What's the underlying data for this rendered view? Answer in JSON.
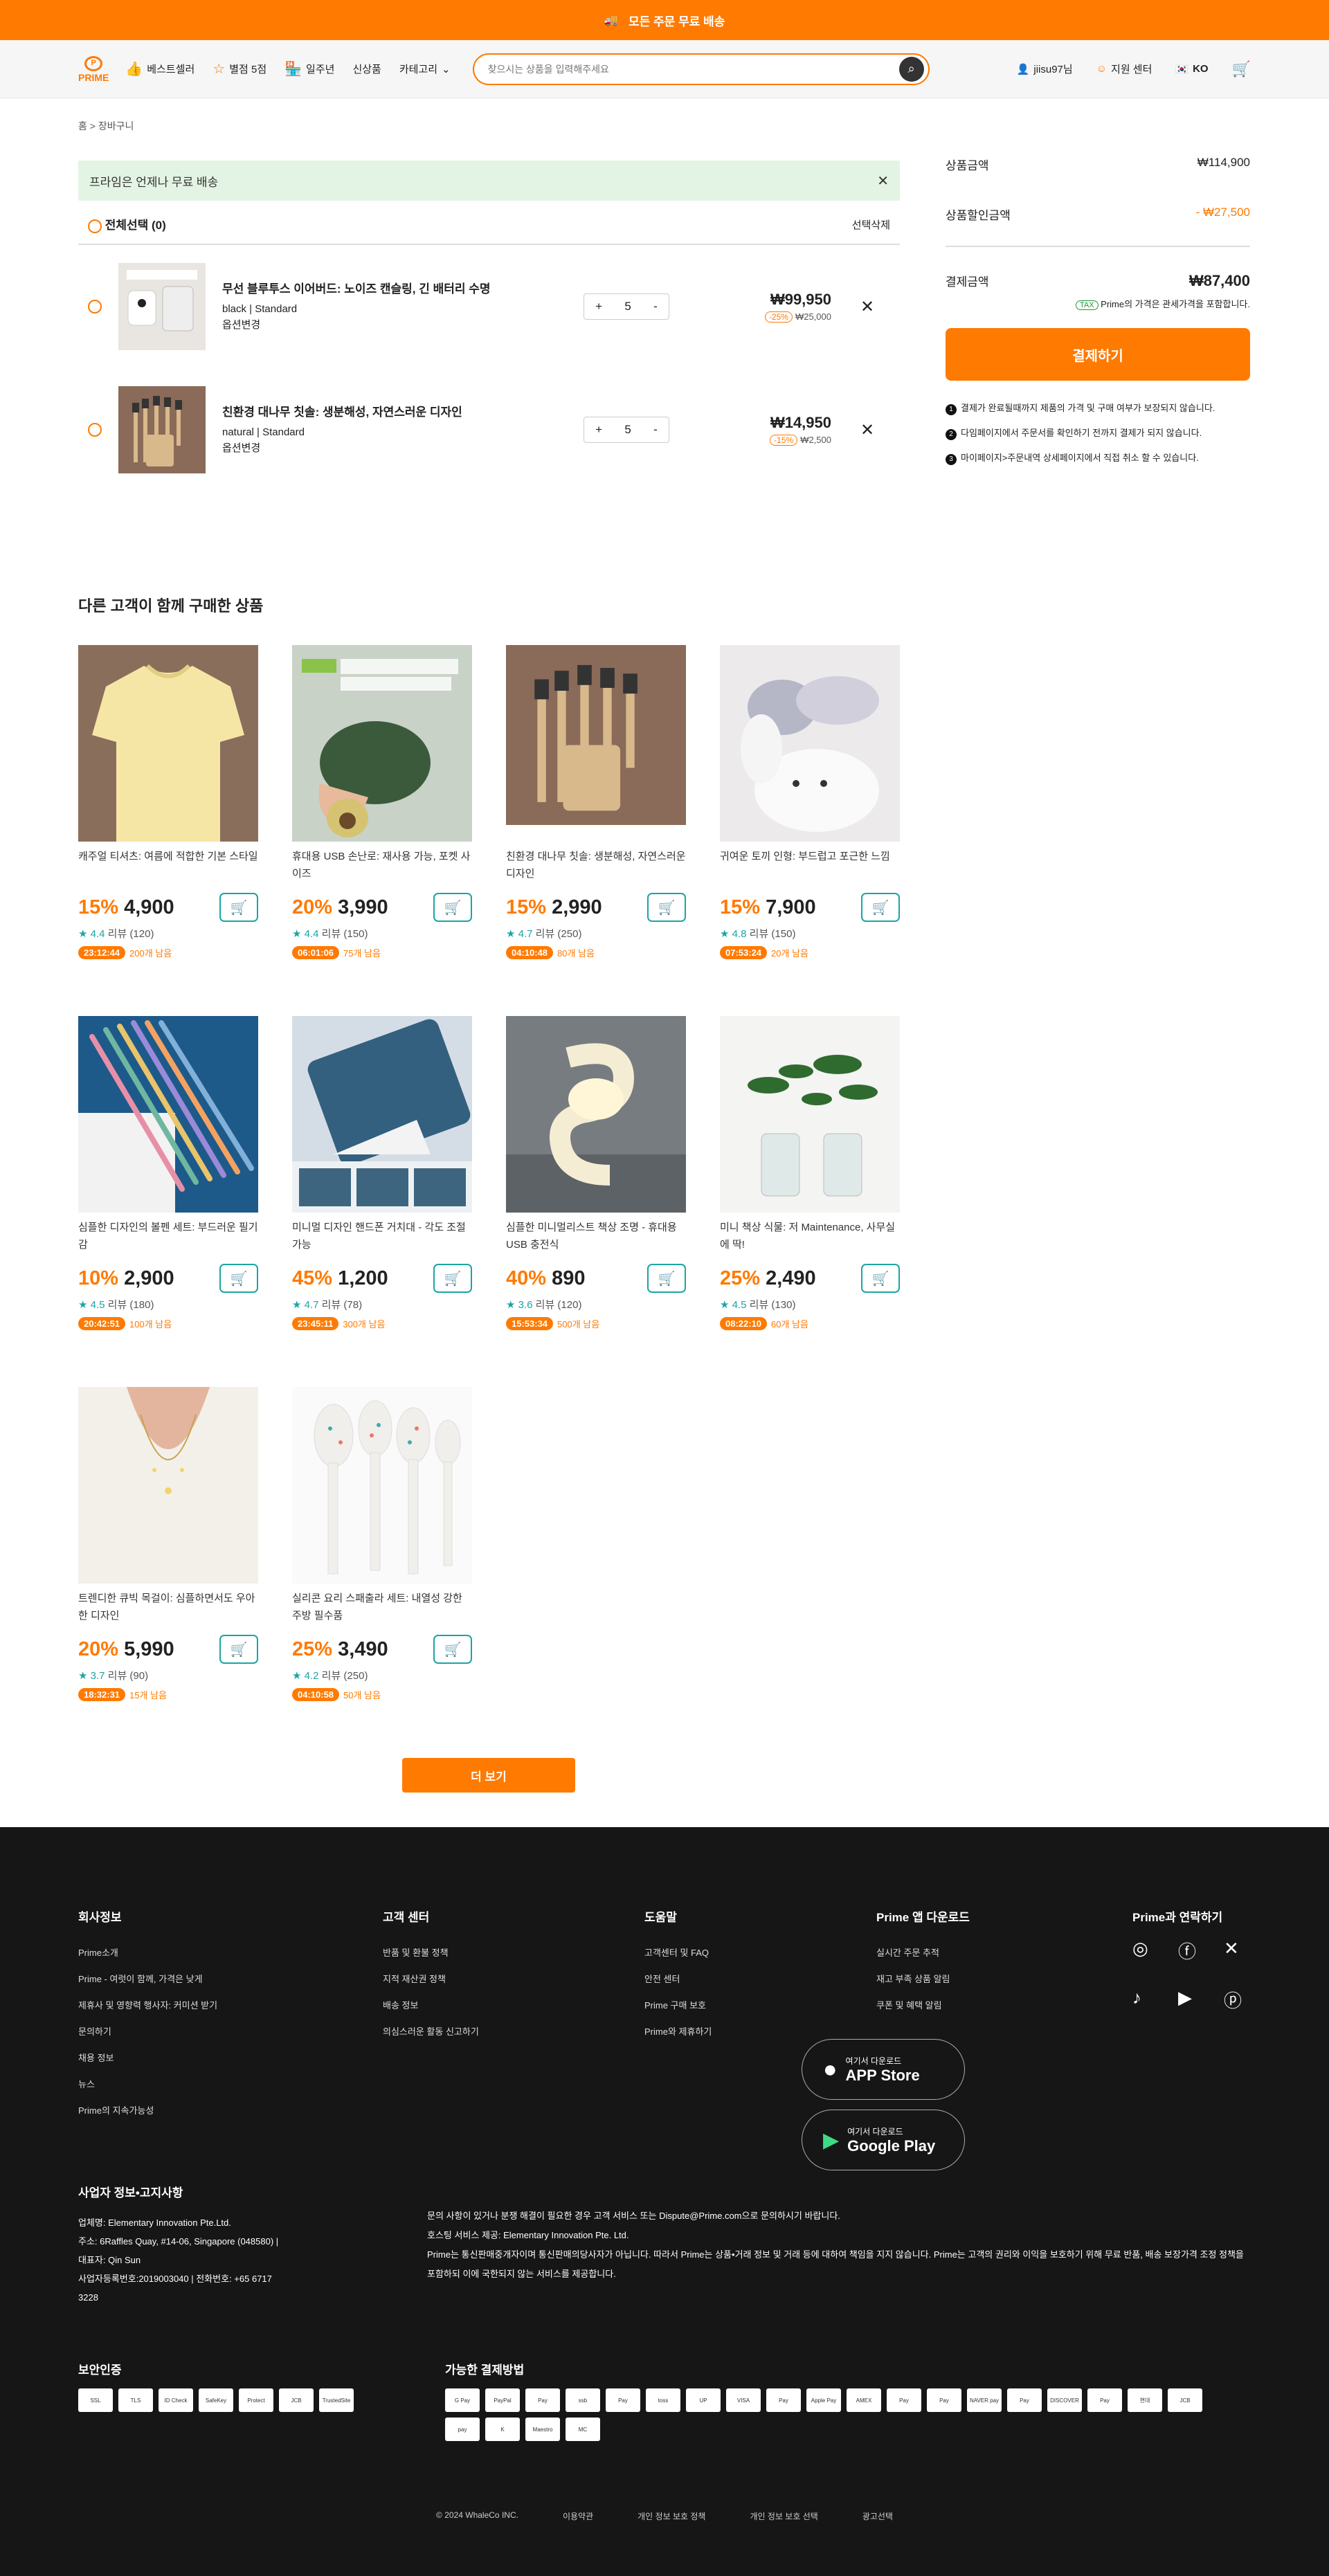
{
  "topbar": {
    "text": "모든 주문 무료 배송"
  },
  "header": {
    "logo": "PRIME",
    "nav": [
      {
        "label": "베스트셀러",
        "icon": "thumbs-up-icon"
      },
      {
        "label": "별점 5점",
        "icon": "star-icon"
      },
      {
        "label": "일주년",
        "icon": "store-icon"
      },
      {
        "label": "신상품",
        "icon": ""
      },
      {
        "label": "카테고리",
        "icon": "chevron-down-icon"
      }
    ],
    "search_placeholder": "찾으시는 상품을 입력해주세요",
    "user": "jiisu97님",
    "support": "지원 센터",
    "lang": "KO"
  },
  "breadcrumb": {
    "home": "홈",
    "current": "> 장바구니"
  },
  "notice": "프라임은 언제나 무료 배송",
  "select_all": "전체선택 (0)",
  "delete_selected": "선택삭제",
  "cart_items": [
    {
      "title": "무선 블루투스 이어버드: 노이즈 캔슬링, 긴 배터리 수명",
      "variant": "black | Standard",
      "option": "옵션변경",
      "qty": "5",
      "price": "₩99,950",
      "discount": "-25%",
      "original": "₩25,000",
      "img": "earbuds"
    },
    {
      "title": "친환경 대나무 칫솔: 생분해성, 자연스러운 디자인",
      "variant": "natural | Standard",
      "option": "옵션변경",
      "qty": "5",
      "price": "₩14,950",
      "discount": "-15%",
      "original": "₩2,500",
      "img": "toothbrush"
    }
  ],
  "summary": {
    "subtotal_label": "상품금액",
    "subtotal": "₩114,900",
    "discount_label": "상품할인금액",
    "discount": "- ₩27,500",
    "total_label": "결제금액",
    "total": "₩87,400",
    "tax_badge": "TAX",
    "tax_note": "Prime의 가격은 관세가격을 포함합니다.",
    "pay_button": "결제하기",
    "rules": [
      "결제가 완료될때까지 제품의 가격 및 구매 여부가 보장되지 않습니다.",
      "다임페이지에서 주문서를 확인하기 전까지 결제가 되지 않습니다.",
      "마이페이지>주문내역 상세페이지에서 직접 취소 할 수 있습니다."
    ]
  },
  "recommend_title": "다른 고객이 함께 구매한 상품",
  "products": [
    {
      "name": "캐주얼 티셔츠: 여름에 적합한 기본 스타일",
      "pct": "15%",
      "price": "4,900",
      "rating": "4.4",
      "reviews": "리뷰 (120)",
      "timer": "23:12:44",
      "left": "200개 남음",
      "img": "tshirt"
    },
    {
      "name": "휴대용 USB 손난로: 재사용 가능, 포켓 사이즈",
      "pct": "20%",
      "price": "3,990",
      "rating": "4.4",
      "reviews": "리뷰 (150)",
      "timer": "06:01:06",
      "left": "75개 남음",
      "img": "warmer"
    },
    {
      "name": "친환경 대나무 칫솔: 생분해성, 자연스러운 디자인",
      "pct": "15%",
      "price": "2,990",
      "rating": "4.7",
      "reviews": "리뷰 (250)",
      "timer": "04:10:48",
      "left": "80개 남음",
      "img": "toothbrush"
    },
    {
      "name": "귀여운 토끼 인형: 부드럽고 포근한 느낌",
      "pct": "15%",
      "price": "7,900",
      "rating": "4.8",
      "reviews": "리뷰 (150)",
      "timer": "07:53:24",
      "left": "20개 남음",
      "img": "bunny"
    },
    {
      "name": "심플한 디자인의 볼펜 세트: 부드러운 필기감",
      "pct": "10%",
      "price": "2,900",
      "rating": "4.5",
      "reviews": "리뷰 (180)",
      "timer": "20:42:51",
      "left": "100개 남음",
      "img": "pens"
    },
    {
      "name": "미니멀 디자인 핸드폰 거치대 - 각도 조절 가능",
      "pct": "45%",
      "price": "1,200",
      "rating": "4.7",
      "reviews": "리뷰 (78)",
      "timer": "23:45:11",
      "left": "300개 남음",
      "img": "stand"
    },
    {
      "name": "심플한 미니멀리스트 책상 조명 - 휴대용 USB 충전식",
      "pct": "40%",
      "price": "890",
      "rating": "3.6",
      "reviews": "리뷰 (120)",
      "timer": "15:53:34",
      "left": "500개 남음",
      "img": "lamp"
    },
    {
      "name": "미니 책상 식물: 저 Maintenance, 사무실에 딱!",
      "pct": "25%",
      "price": "2,490",
      "rating": "4.5",
      "reviews": "리뷰 (130)",
      "timer": "08:22:10",
      "left": "60개 남음",
      "img": "plants"
    },
    {
      "name": "트렌디한 큐빅 목걸이: 심플하면서도 우아한 디자인",
      "pct": "20%",
      "price": "5,990",
      "rating": "3.7",
      "reviews": "리뷰 (90)",
      "timer": "18:32:31",
      "left": "15개 남음",
      "img": "necklace"
    },
    {
      "name": "실리콘 요리 스패출라 세트: 내열성 강한 주방 필수품",
      "pct": "25%",
      "price": "3,490",
      "rating": "4.2",
      "reviews": "리뷰 (250)",
      "timer": "04:10:58",
      "left": "50개 남음",
      "img": "spatula"
    }
  ],
  "more_button": "더 보기",
  "footer": {
    "col1": {
      "title": "회사정보",
      "links": [
        "Prime소개",
        "Prime - 여럿이 함께, 가격은 낮게",
        "제휴사 및 영향력 행사자: 커미션 받기",
        "문의하기",
        "채용 정보",
        "뉴스",
        "Prime의 지속가능성"
      ]
    },
    "col2": {
      "title": "고객 센터",
      "links": [
        "반품 및 환불 정책",
        "지적 재산권 정책",
        "배송 정보",
        "의심스러운 활동 신고하기"
      ]
    },
    "col3": {
      "title": "도움말",
      "links": [
        "고객센터 및 FAQ",
        "안전 센터",
        "Prime 구매 보호",
        "Prime와 제휴하기"
      ]
    },
    "col4": {
      "title": "Prime 앱 다운로드",
      "links": [
        "실시간 주문 추적",
        "재고 부족 상품 알림",
        "쿠폰 및 혜택 알림"
      ]
    },
    "appstore": {
      "small": "여기서 다운로드",
      "big": "APP Store"
    },
    "googleplay": {
      "small": "여기서 다운로드",
      "big": "Google Play"
    },
    "contact_title": "Prime과 연락하기",
    "biz": {
      "title": "사업자 정보•고지사항",
      "lines": [
        "업체명: Elementary Innovation Pte.Ltd.",
        "주소: 6Raffles Quay, #14-06, Singapore (048580) | 대표자: Qin Sun",
        "사업자등록번호:2019003040 | 전화번호: +65 6717 3228"
      ]
    },
    "bizr": [
      "문의 사항이 있거나 분쟁 해결이 필요한 경우 고객 서비스 또는 Dispute@Prime.com으로 문의하시기 바랍니다.",
      "호스팅 서비스 제공: Elementary Innovation Pte. Ltd.",
      "Prime는 통신판매중개자이며 통신판매의당사자가 아닙니다. 따라서 Prime는 상품•거래 정보 및 거래 등에 대하여 책임을 지지 않습니다. Prime는 고객의 권리와 이익을 보호하기 위해 무료 반품, 배송 보장가격 조정 정책을 포함하되 이에 국한되지 않는 서비스를 제공합니다."
    ],
    "security_title": "보안인증",
    "security": [
      "SSL",
      "TLS",
      "ID Check",
      "SafeKey",
      "Protect",
      "JCB",
      "TrustedSite"
    ],
    "payments_title": "가능한 결제방법",
    "payments": [
      "G Pay",
      "PayPal",
      "Pay",
      "ssb",
      "Pay",
      "toss",
      "UP",
      "VISA",
      "Pay",
      "Apple Pay",
      "AMEX",
      "Pay",
      "Pay",
      "NAVER pay",
      "Pay",
      "DISCOVER",
      "Pay",
      "현대",
      "JCB",
      "pay",
      "K",
      "Maestro",
      "MC"
    ],
    "bottom": [
      "© 2024 WhaleCo INC.",
      "이용약관",
      "개인 정보 보호 정책",
      "개인 정보 보호 선택",
      "광고선택"
    ]
  }
}
